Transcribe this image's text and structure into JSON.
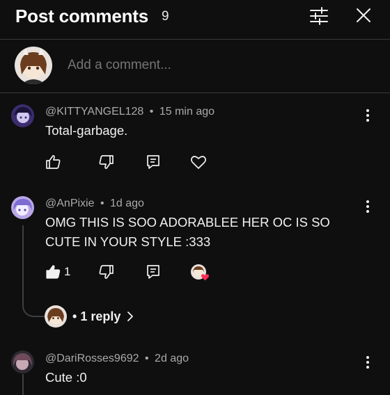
{
  "header": {
    "title": "Post comments",
    "count": "9",
    "filter_icon": "sliders-icon",
    "close_icon": "close-icon"
  },
  "add_comment": {
    "placeholder": "Add a comment..."
  },
  "comments": [
    {
      "author": "@KITTYANGEL128",
      "time": "15 min ago",
      "text": "Total-garbage.",
      "likes": "",
      "liked": false,
      "avatar_colors": [
        "#3b2d6e",
        "#cfc8f0"
      ]
    },
    {
      "author": "@AnPixie",
      "time": "1d ago",
      "text_line1": "OMG THIS IS SOO ADORABLEE HER OC IS SO",
      "text_line2": "CUTE IN YOUR STYLE :333",
      "likes": "1",
      "liked": true,
      "hearted_by_creator": true,
      "replies_label": "1 reply",
      "avatar_colors": [
        "#b9a6e8",
        "#7c6bd0"
      ]
    },
    {
      "author": "@DariRosses9692",
      "time": "2d ago",
      "text": "Cute :0",
      "avatar_colors": [
        "#6e4a5a",
        "#2d2a33"
      ]
    }
  ],
  "separator": "•",
  "colors": {
    "background": "#0f0f0f",
    "text": "#f1f1f1",
    "muted": "#aaaaaa",
    "heart": "#ff2d55"
  }
}
